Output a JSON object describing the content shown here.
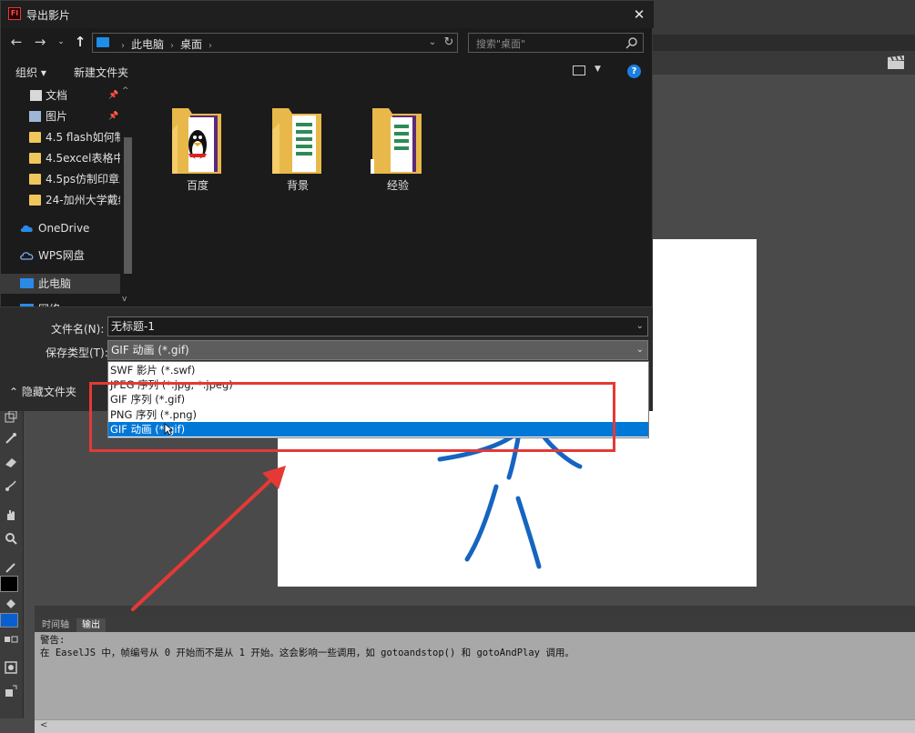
{
  "dialog": {
    "title": "导出影片",
    "app_logo": "Fl",
    "close_glyph": "✕"
  },
  "address": {
    "crumbs": [
      "此电脑",
      "桌面"
    ],
    "search_placeholder": "搜索\"桌面\""
  },
  "commandbar": {
    "organize": "组织 ▾",
    "new_folder": "新建文件夹"
  },
  "nav_items": [
    {
      "label": "文档",
      "icon": "document-icon",
      "pinned": true
    },
    {
      "label": "图片",
      "icon": "picture-icon",
      "pinned": true
    },
    {
      "label": "4.5 flash如何制",
      "icon": "folder-icon"
    },
    {
      "label": "4.5excel表格中",
      "icon": "folder-icon"
    },
    {
      "label": "4.5ps仿制印章工",
      "icon": "folder-icon"
    },
    {
      "label": "24-加州大学戴维",
      "icon": "folder-icon"
    },
    {
      "label": "OneDrive",
      "icon": "cloud-icon"
    },
    {
      "label": "WPS网盘",
      "icon": "cloud-outline-icon"
    },
    {
      "label": "此电脑",
      "icon": "computer-icon",
      "selected": true
    },
    {
      "label": "网络",
      "icon": "network-icon"
    }
  ],
  "files": [
    {
      "name": "百度",
      "kind": "folder-with-penguin"
    },
    {
      "name": "背景",
      "kind": "folder-with-sheet"
    },
    {
      "name": "经验",
      "kind": "folder-shortcut"
    }
  ],
  "form": {
    "filename_label": "文件名(N):",
    "filename_value": "无标题-1",
    "filetype_label": "保存类型(T):",
    "filetype_value": "GIF 动画 (*.gif)",
    "hide_folders": "隐藏文件夹"
  },
  "filetype_options": [
    {
      "label": "SWF 影片 (*.swf)",
      "selected": false
    },
    {
      "label": "JPEG 序列 (*.jpg; *.jpeg)",
      "selected": false
    },
    {
      "label": "GIF 序列 (*.gif)",
      "selected": false
    },
    {
      "label": "PNG 序列 (*.png)",
      "selected": false
    },
    {
      "label": "GIF 动画 (*.gif)",
      "selected": true
    }
  ],
  "panels": {
    "timeline_tab": "时间轴",
    "output_tab": "输出",
    "output_line1": "警告:",
    "output_line2": "在 EaselJS 中，帧编号从 0 开始而不是从 1 开始。这会影响一些调用，如 gotoandstop() 和 gotoAndPlay 调用。",
    "scroll_left": "<"
  },
  "colors": {
    "accent": "#0078d7",
    "annotation": "#e53935",
    "drawing": "#1565c0"
  }
}
